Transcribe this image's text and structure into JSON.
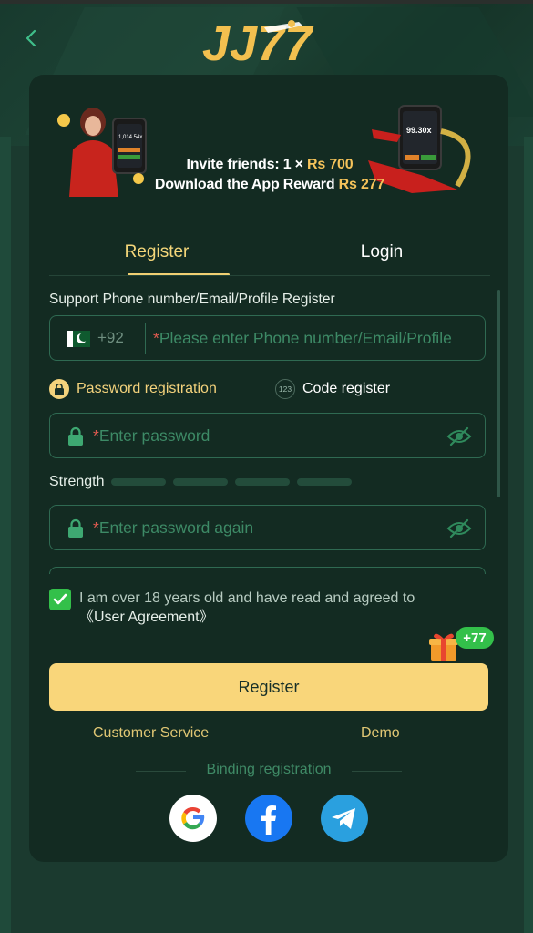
{
  "header": {
    "logo_text": "JJ77"
  },
  "banner": {
    "line1_prefix": "Invite friends: 1 × ",
    "line1_amount": "Rs 700",
    "line2_prefix": "Download the App Reward ",
    "line2_amount": "Rs 277",
    "phone_left_value": "1,014.54x",
    "phone_right_value": "99.30x"
  },
  "tabs": {
    "register": "Register",
    "login": "Login",
    "active": "Register"
  },
  "form": {
    "support_label": "Support Phone number/Email/Profile Register",
    "country_code": "+92",
    "phone_placeholder": "Please enter Phone number/Email/Profile",
    "required_mark": "*",
    "mode_password": "Password registration",
    "mode_code": "Code register",
    "mode_code_icon_text": "123",
    "password_placeholder": "Enter password",
    "strength_label": "Strength",
    "strength_level": 0,
    "confirm_placeholder": "Enter password again",
    "agree_text": "I am over 18 years old and have read and agreed to",
    "agree_link": "《User Agreement》",
    "agree_checked": true
  },
  "bonus": {
    "badge": "+77"
  },
  "actions": {
    "register_button": "Register",
    "customer_service": "Customer Service",
    "demo": "Demo"
  },
  "binding": {
    "label": "Binding registration",
    "providers": [
      "google",
      "facebook",
      "telegram"
    ]
  },
  "colors": {
    "background": "#1b3a2f",
    "card": "#132b22",
    "accent_gold": "#f9d67a",
    "input_border": "#2f6a52",
    "checkbox_green": "#33c04a"
  }
}
